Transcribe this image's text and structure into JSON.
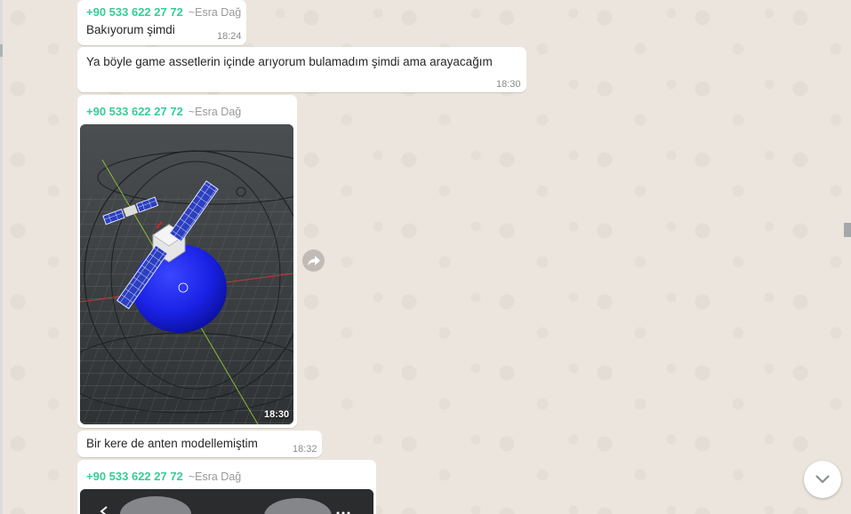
{
  "messages": [
    {
      "sender_phone": "+90 533 622 27 72",
      "sender_name": "~Esra Dağ",
      "text": "Bakıyorum şimdi",
      "time": "18:24"
    },
    {
      "text": "Ya böyle game assetlerin içinde arıyorum bulamadım şimdi ama arayacağım",
      "time": "18:30"
    },
    {
      "sender_phone": "+90 533 622 27 72",
      "sender_name": "~Esra Dağ",
      "media": "image",
      "time": "18:30"
    },
    {
      "text": "Bir kere de anten modellemiştim",
      "time": "18:32"
    },
    {
      "sender_phone": "+90 533 622 27 72",
      "sender_name": "~Esra Dağ",
      "media": "image"
    }
  ],
  "icons": {
    "forward": "forward-arrow-icon",
    "scroll_down": "chevron-down-icon",
    "back": "chevron-left-icon",
    "more": "more-icon"
  },
  "colors": {
    "sender": "#35cd96",
    "bubble": "#ffffff",
    "background": "#ece5dd"
  }
}
